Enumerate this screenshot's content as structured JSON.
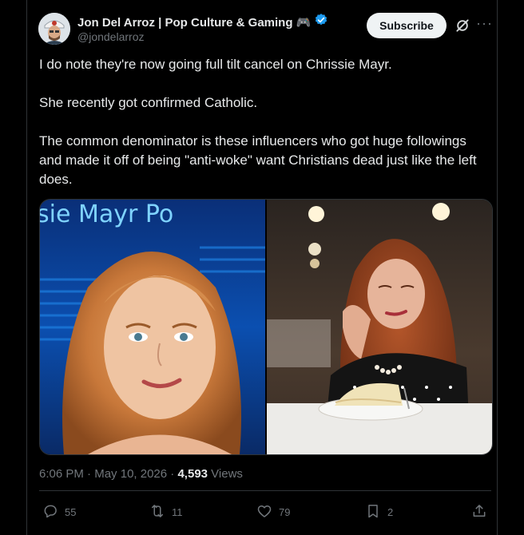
{
  "author": {
    "display_name": "Jon Del Arroz | Pop Culture & Gaming 🎮",
    "handle": "@jondelarroz"
  },
  "subscribe_label": "Subscribe",
  "tweet": {
    "paragraphs": [
      "I do note they're now going full tilt cancel on Chrissie Mayr.",
      "She recently got confirmed Catholic.",
      "The common denominator is these influencers who got huge followings and made it off of being \"anti-woke\" want Christians dead just like the left does."
    ],
    "image_overlay_text": "sie Mayr Po"
  },
  "meta": {
    "time": "6:06 PM",
    "separator": " · ",
    "date": "May 10, 2026",
    "views_count": "4,593",
    "views_label": " Views"
  },
  "actions": {
    "replies": "55",
    "reposts": "11",
    "likes": "79",
    "bookmarks": "2"
  },
  "colors": {
    "background": "#000000",
    "text": "#e7e9ea",
    "muted": "#71767b",
    "verified": "#1d9bf0"
  }
}
